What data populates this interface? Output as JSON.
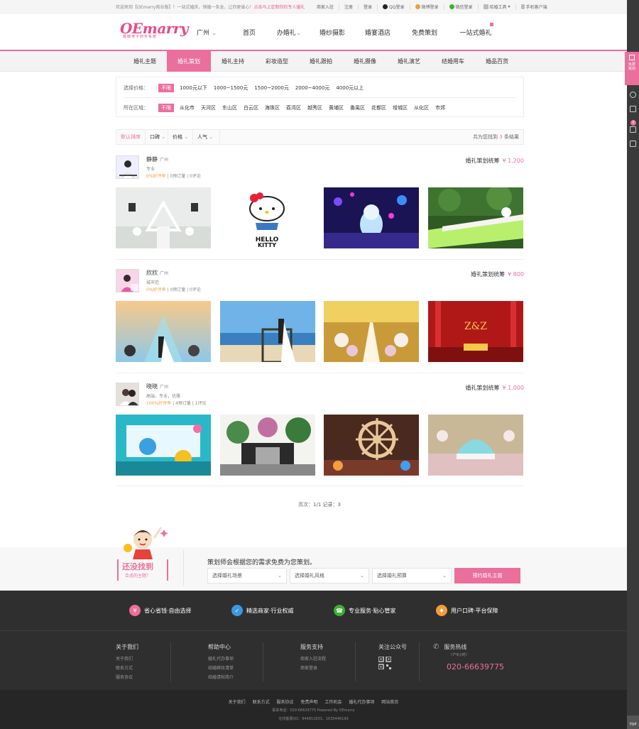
{
  "topbar": {
    "welcome": "欢迎来到【OEmarry商业版】！一站式婚庆，销婚一条龙，让你更省心！",
    "welcome_highlight": "点击马上定制你的专人婚礼",
    "links": [
      "商家入驻",
      "注册",
      "登录",
      "QQ登录",
      "微博登录",
      "微信登录",
      "给婚工具",
      "手机客户端"
    ]
  },
  "header": {
    "logo": "OEmarry",
    "logo_sub": "婚嫁电子商务系统",
    "city": "广州",
    "nav": [
      "首页",
      "办婚礼",
      "婚纱摄影",
      "婚宴酒店",
      "免费策划",
      "一站式婚礼"
    ]
  },
  "subnav": {
    "items": [
      "婚礼主题",
      "婚礼策划",
      "婚礼主持",
      "彩妆造型",
      "婚礼跟拍",
      "婚礼摄像",
      "婚礼演艺",
      "结婚用车",
      "婚品百货"
    ],
    "active_index": 1
  },
  "filter": {
    "price_label": "选择价格：",
    "prices": [
      "不限",
      "1000元以下",
      "1000~1500元",
      "1500~2000元",
      "2000~4000元",
      "4000元以上"
    ],
    "area_label": "所在区域：",
    "areas": [
      "不限",
      "从化市",
      "天河区",
      "东山区",
      "白云区",
      "海珠区",
      "荔湾区",
      "越秀区",
      "黄埔区",
      "番禺区",
      "花都区",
      "增城区",
      "从化区",
      "市郊"
    ]
  },
  "sortbar": {
    "options": [
      "默认排序",
      "口碑",
      "价格",
      "人气"
    ],
    "total_prefix": "共为您找到",
    "total_count": "3",
    "total_suffix": "条结果"
  },
  "listings": [
    {
      "name": "静静",
      "city": "广州",
      "tag": "专业",
      "rating": "0%好评率",
      "orders": "0预订量",
      "reviews": "0评论",
      "price_label": "婚礼策划统筹",
      "price": "¥ 1,200"
    },
    {
      "name": "欣欣",
      "city": "广州",
      "tag": "城市范",
      "rating": "0%好评率",
      "orders": "0预订量",
      "reviews": "0评论",
      "price_label": "婚礼策划统筹",
      "price": "¥ 800"
    },
    {
      "name": "晓晓",
      "city": "广州",
      "tag": "高端，专业，优雅",
      "rating": "100%好评率",
      "orders": "4预订量",
      "reviews": "1评论",
      "price_label": "婚礼策划统筹",
      "price": "¥ 1,000"
    }
  ],
  "pager": "页次：1/1  记录：3",
  "cta": {
    "slogan_1": "还没找到",
    "slogan_2": "合适的主题？",
    "title": "策划师会根据您的需求免费为您策划。",
    "selects": [
      "选择婚礼场景",
      "选择婚礼风格",
      "选择婚礼预算"
    ],
    "button": "预约婚礼主题"
  },
  "features": [
    "省心省钱·自由选择",
    "精选商家·行业权威",
    "专业服务·贴心管家",
    "用户口碑·平台保障"
  ],
  "footer": {
    "about": {
      "title": "关于我们",
      "links": [
        "关于我们",
        "联系方式",
        "服务协议"
      ]
    },
    "help": {
      "title": "帮助中心",
      "links": [
        "婚礼代办事项",
        "结婚嫁妆清单",
        "结婚请帖简介"
      ]
    },
    "support": {
      "title": "服务支持",
      "links": [
        "商家入驻流程",
        "商家登录"
      ]
    },
    "wechat": {
      "title": "关注公众号"
    },
    "hotline": {
      "title": "服务热线",
      "hours": "（7*9小时）",
      "number": "020-66639775"
    }
  },
  "bottom": {
    "links": [
      "关于我们",
      "联系方式",
      "服务协议",
      "免责声明",
      "工作机会",
      "婚礼代办事项",
      "网站首页"
    ],
    "line2": "联系电话：020-66639775   Powered By  OEmarry",
    "line3": "在线客服QQ：944811833，1635446199"
  },
  "sidebar": {
    "tab": "免费策划",
    "cart_count": "0",
    "top": "TOP"
  },
  "colors": {
    "accent": "#ea6f9b",
    "footer": "#2f2f2f"
  }
}
